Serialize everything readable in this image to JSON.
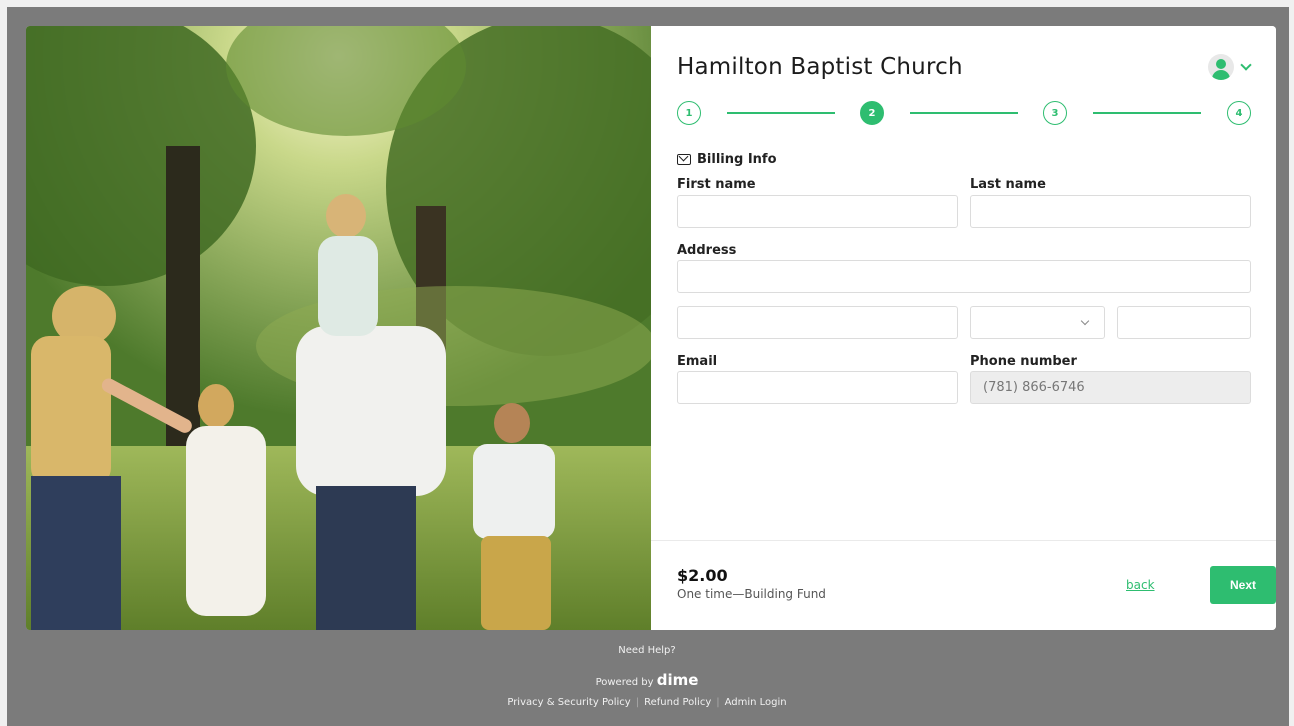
{
  "org": {
    "title": "Hamilton Baptist Church"
  },
  "user_menu": {
    "icon": "user-avatar-icon",
    "chevron": "chevron-down-icon"
  },
  "stepper": {
    "steps": [
      "1",
      "2",
      "3",
      "4"
    ],
    "active": 2
  },
  "billing": {
    "section_title": "Billing Info",
    "first_name_label": "First name",
    "last_name_label": "Last name",
    "address_label": "Address",
    "email_label": "Email",
    "phone_label": "Phone number",
    "phone_value": "(781) 866-6746"
  },
  "summary": {
    "amount": "$2.00",
    "description": "One time—Building Fund"
  },
  "actions": {
    "back_label": "back",
    "next_label": "Next"
  },
  "footer": {
    "help": "Need Help?",
    "powered_prefix": "Powered by",
    "powered_brand": "dime",
    "links": [
      "Privacy & Security Policy",
      "Refund Policy",
      "Admin Login"
    ]
  },
  "colors": {
    "accent": "#2ebd70",
    "backdrop": "#7b7b7b"
  }
}
